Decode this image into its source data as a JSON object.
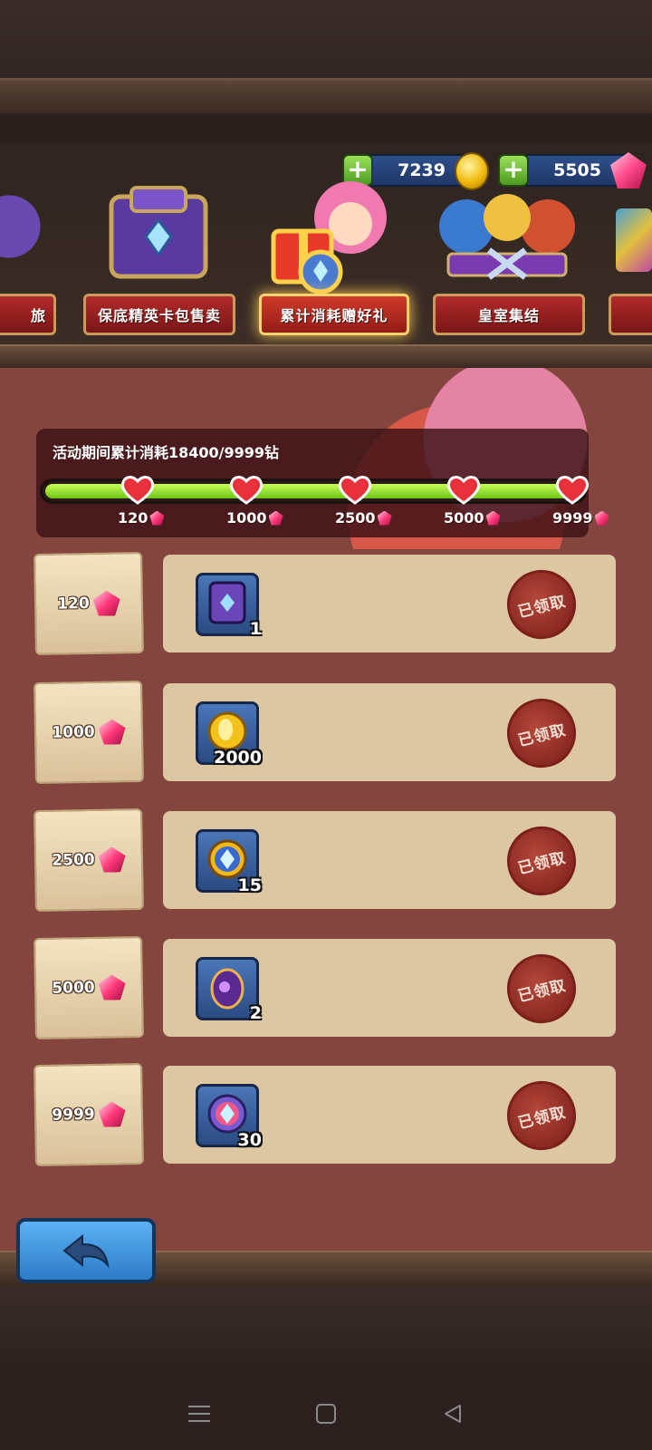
{
  "currencies": {
    "gold": "7239",
    "diamonds": "5505"
  },
  "tabs": [
    {
      "label": "旅",
      "active": false
    },
    {
      "label": "保底精英卡包售卖",
      "active": false
    },
    {
      "label": "累计消耗赠好礼",
      "active": true
    },
    {
      "label": "皇室集结",
      "active": false
    }
  ],
  "progress": {
    "title": "活动期间累计消耗18400/9999钻",
    "fill_fraction": 1.0,
    "milestones": [
      "120",
      "1000",
      "2500",
      "5000",
      "9999"
    ]
  },
  "rewards": [
    {
      "cost": "120",
      "item_icon": "card-pack-icon",
      "qty": "1",
      "status": "已领取"
    },
    {
      "cost": "1000",
      "item_icon": "gold-coin-icon",
      "qty": "2000",
      "status": "已领取"
    },
    {
      "cost": "2500",
      "item_icon": "diamond-medal-icon",
      "qty": "15",
      "status": "已领取"
    },
    {
      "cost": "5000",
      "item_icon": "purple-egg-icon",
      "qty": "2",
      "status": "已领取"
    },
    {
      "cost": "9999",
      "item_icon": "rainbow-orb-icon",
      "qty": "30",
      "status": "已领取"
    }
  ],
  "colors": {
    "panel_bg": "#84453f",
    "card_bg": "#dcc7a2",
    "progress_green": "#8bdc2a",
    "seal_red": "#8b2a22"
  }
}
